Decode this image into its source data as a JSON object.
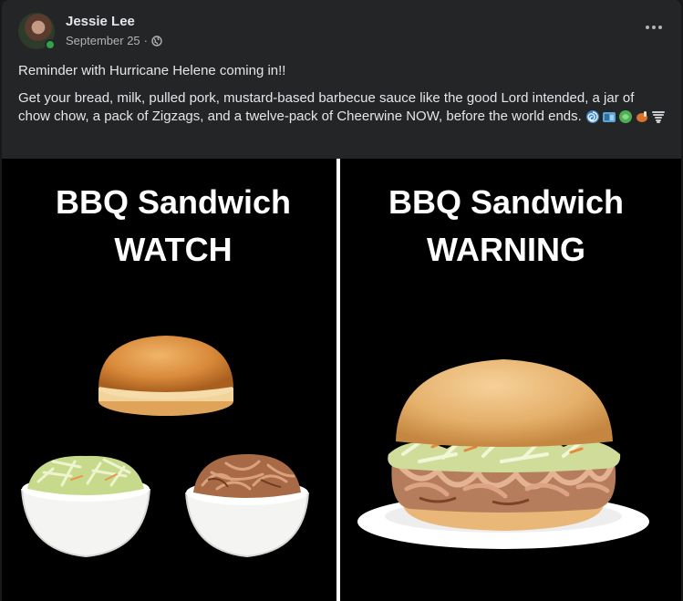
{
  "post": {
    "author": "Jessie Lee",
    "date": "September 25",
    "separator": "·",
    "privacy_icon": "globe-icon",
    "paragraphs": [
      "Reminder with Hurricane Helene coming in!!",
      "Get your bread, milk, pulled pork, mustard-based barbecue sauce like the good Lord intended, a jar of chow chow, a pack of Zigzags, and a twelve-pack of Cheerwine NOW, before the world ends."
    ],
    "emojis": [
      "cyclone-emoji",
      "bread-emoji",
      "leafy-green-emoji",
      "meat-emoji",
      "tornado-emoji"
    ]
  },
  "image": {
    "left_title_line1": "BBQ Sandwich",
    "left_title_line2": "WATCH",
    "right_title_line1": "BBQ Sandwich",
    "right_title_line2": "WARNING"
  },
  "colors": {
    "card_background": "#242526",
    "text_primary": "#e4e6eb",
    "text_secondary": "#b0b3b8",
    "online_green": "#31a24c",
    "image_background": "#000000"
  }
}
